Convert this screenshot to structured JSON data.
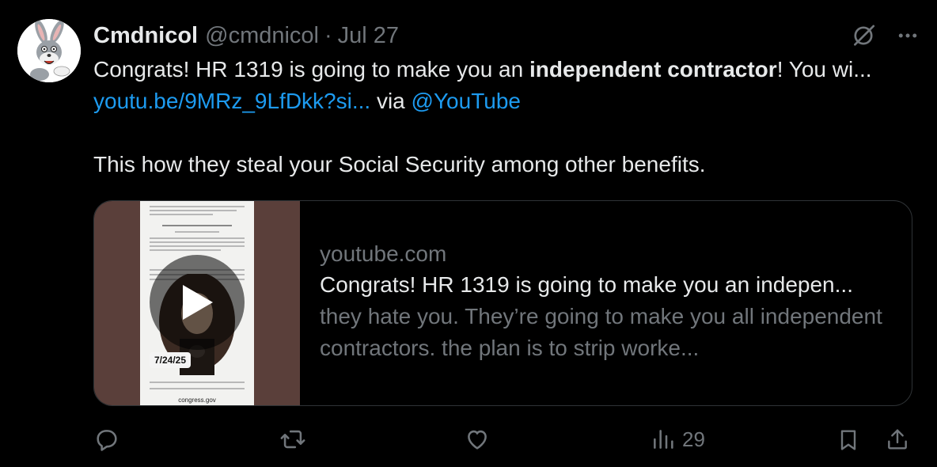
{
  "tweet": {
    "author_name": "Cmdnicol",
    "handle": "@cmdnicol",
    "separator": "·",
    "date": "Jul 27",
    "text": {
      "part1": "Congrats! HR 1319 is going to make you an ",
      "bold": "independent contractor",
      "part2": "! You wi... ",
      "link1": "youtu.be/9MRz_9LfDkk?si...",
      "via": " via ",
      "mention": "@YouTube",
      "second_paragraph": "This how they steal your Social Security among other benefits."
    }
  },
  "card": {
    "domain": "youtube.com",
    "title": "Congrats! HR 1319 is going to make you an indepen...",
    "description": "they hate you. They’re going to make you all independent contractors. the plan is to strip worke...",
    "thumbnail": {
      "date_badge": "7/24/25",
      "footer_text": "congress.gov",
      "paper_heading": "IN THE HOUSE OF REPRESENTATIVES"
    }
  },
  "actions": {
    "reply_icon": "reply-icon",
    "retweet_icon": "retweet-icon",
    "like_icon": "heart-icon",
    "views_icon": "views-icon",
    "views_count": "29",
    "bookmark_icon": "bookmark-icon",
    "share_icon": "share-icon"
  },
  "colors": {
    "background": "#000000",
    "text": "#e7e9ea",
    "muted": "#71767b",
    "link": "#1d9bf0",
    "border": "#2f3336"
  }
}
